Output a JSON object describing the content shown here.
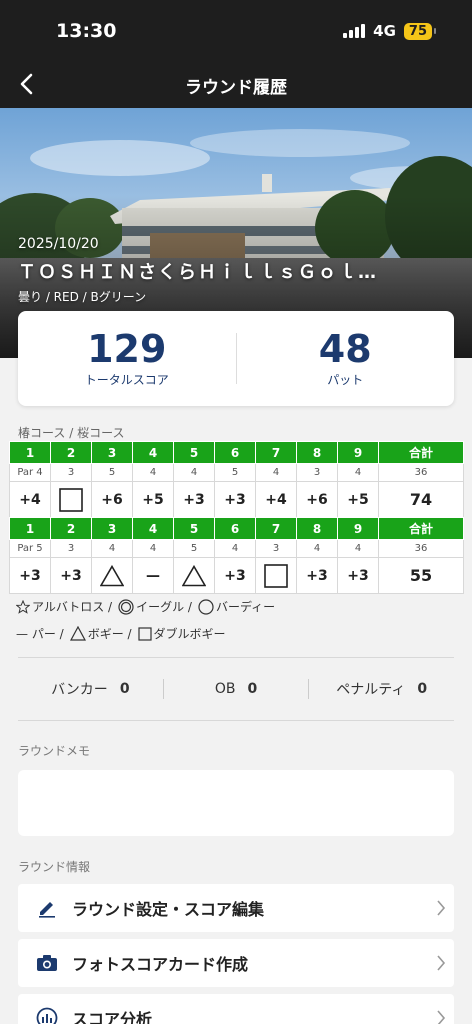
{
  "status_bar": {
    "time": "13:30",
    "network": "4G",
    "battery": "75"
  },
  "nav": {
    "title": "ラウンド履歴"
  },
  "round": {
    "date": "2025/10/20",
    "course": "ＴＯＳＨＩＮさくらＨｉｌｌｓＧｏｌ…",
    "conditions": "曇り / RED  / Bグリーン"
  },
  "summary": {
    "total_score": "129",
    "total_score_label": "トータルスコア",
    "putts": "48",
    "putts_label": "パット"
  },
  "course_label": "椿コース / 桜コース",
  "scorecard": [
    {
      "holes": [
        "1",
        "2",
        "3",
        "4",
        "5",
        "6",
        "7",
        "8",
        "9",
        "合計"
      ],
      "par_label": "Par 4",
      "pars": [
        "3",
        "5",
        "4",
        "4",
        "5",
        "4",
        "3",
        "4",
        "36"
      ],
      "scores": [
        {
          "text": "+4",
          "symbol": ""
        },
        {
          "text": "",
          "symbol": "square"
        },
        {
          "text": "+6",
          "symbol": ""
        },
        {
          "text": "+5",
          "symbol": ""
        },
        {
          "text": "+3",
          "symbol": ""
        },
        {
          "text": "+3",
          "symbol": ""
        },
        {
          "text": "+4",
          "symbol": ""
        },
        {
          "text": "+6",
          "symbol": ""
        },
        {
          "text": "+5",
          "symbol": ""
        }
      ],
      "total": "74"
    },
    {
      "holes": [
        "1",
        "2",
        "3",
        "4",
        "5",
        "6",
        "7",
        "8",
        "9",
        "合計"
      ],
      "par_label": "Par 5",
      "pars": [
        "3",
        "4",
        "4",
        "5",
        "4",
        "3",
        "4",
        "4",
        "36"
      ],
      "scores": [
        {
          "text": "+3",
          "symbol": ""
        },
        {
          "text": "+3",
          "symbol": ""
        },
        {
          "text": "",
          "symbol": "triangle"
        },
        {
          "text": "—",
          "symbol": ""
        },
        {
          "text": "",
          "symbol": "triangle"
        },
        {
          "text": "+3",
          "symbol": ""
        },
        {
          "text": "",
          "symbol": "square"
        },
        {
          "text": "+3",
          "symbol": ""
        },
        {
          "text": "+3",
          "symbol": ""
        }
      ],
      "total": "55"
    }
  ],
  "legend": {
    "albatross": "アルバトロス /",
    "eagle": "イーグル /",
    "birdie": "バーディー",
    "par": "— パー /",
    "bogey": "ボギー /",
    "double_bogey": "ダブルボギー"
  },
  "stats": {
    "bunker_label": "バンカー",
    "bunker_value": "0",
    "ob_label": "OB",
    "ob_value": "0",
    "penalty_label": "ペナルティ",
    "penalty_value": "0"
  },
  "memo": {
    "title": "ラウンドメモ",
    "text": ""
  },
  "info": {
    "title": "ラウンド情報",
    "items": [
      {
        "label": "ラウンド設定・スコア編集",
        "icon": "pencil-icon"
      },
      {
        "label": "フォトスコアカード作成",
        "icon": "camera-icon"
      },
      {
        "label": "スコア分析",
        "icon": "chart-icon"
      }
    ]
  },
  "colors": {
    "accent_green": "#19a319",
    "score_navy": "#1c3a6e",
    "header_bg": "#1e1e1e",
    "battery": "#f5c518"
  }
}
